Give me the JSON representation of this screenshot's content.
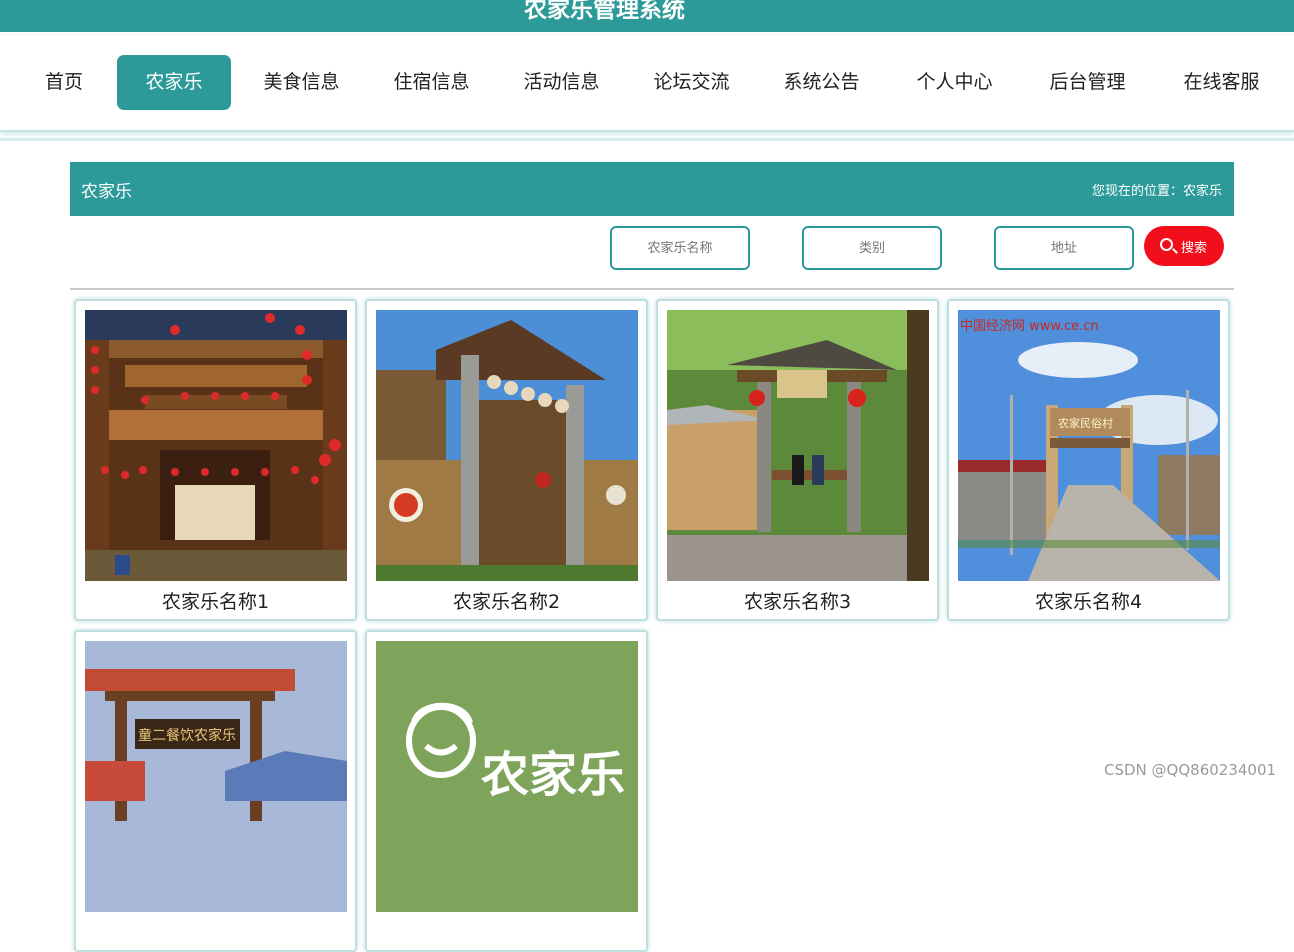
{
  "app": {
    "title": "农家乐管理系统"
  },
  "nav": {
    "items": [
      "首页",
      "农家乐",
      "美食信息",
      "住宿信息",
      "活动信息",
      "论坛交流",
      "系统公告",
      "个人中心",
      "后台管理",
      "在线客服"
    ],
    "active_index": 1
  },
  "breadcrumb": {
    "title": "农家乐",
    "position": "您现在的位置：农家乐"
  },
  "search": {
    "name_placeholder": "农家乐名称",
    "category_placeholder": "类别",
    "address_placeholder": "地址",
    "button_label": "搜索",
    "button_icon": "search-icon"
  },
  "cards": [
    {
      "name": "农家乐名称1"
    },
    {
      "name": "农家乐名称2"
    },
    {
      "name": "农家乐名称3"
    },
    {
      "name": "农家乐名称4"
    },
    {
      "name": ""
    },
    {
      "name": ""
    }
  ],
  "photo_text": {
    "card4_site": "中国经济网 www.ce.cn",
    "card4_gate": "农家民俗村",
    "card5_sign": "童二餐饮农家乐",
    "card6_logo": "农家乐"
  },
  "watermark": "CSDN @QQ860234001",
  "colors": {
    "primary": "#2b9a98",
    "search_button": "#f20f1c",
    "card6_bg": "#7ea45c"
  }
}
